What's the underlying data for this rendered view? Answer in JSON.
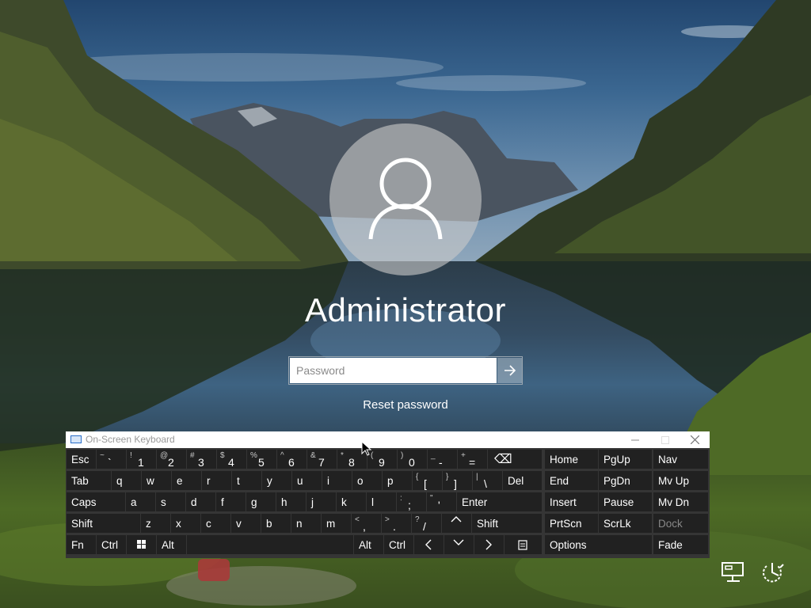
{
  "user": {
    "name": "Administrator"
  },
  "password": {
    "placeholder": "Password"
  },
  "reset_link": "Reset password",
  "osk": {
    "title": "On-Screen Keyboard",
    "keys": {
      "esc": "Esc",
      "tilde_up": "~",
      "tilde_dn": "`",
      "n1_up": "!",
      "n1": "1",
      "n2_up": "@",
      "n2": "2",
      "n3_up": "#",
      "n3": "3",
      "n4_up": "$",
      "n4": "4",
      "n5_up": "%",
      "n5": "5",
      "n6_up": "^",
      "n6": "6",
      "n7_up": "&",
      "n7": "7",
      "n8_up": "*",
      "n8": "8",
      "n9_up": "(",
      "n9": "9",
      "n0_up": ")",
      "n0": "0",
      "minus_up": "_",
      "minus_dn": "-",
      "plus_up": "+",
      "plus_dn": "=",
      "backspace": "⌫",
      "tab": "Tab",
      "q": "q",
      "w": "w",
      "e": "e",
      "r": "r",
      "t": "t",
      "y": "y",
      "u": "u",
      "i": "i",
      "o": "o",
      "p": "p",
      "lbr_up": "{",
      "lbr_dn": "[",
      "rbr_up": "}",
      "rbr_dn": "]",
      "bsl_up": "|",
      "bsl_dn": "\\",
      "del": "Del",
      "caps": "Caps",
      "a": "a",
      "s": "s",
      "d": "d",
      "f": "f",
      "g": "g",
      "h": "h",
      "j": "j",
      "k": "k",
      "l": "l",
      "semi_up": ":",
      "semi_dn": ";",
      "quote_up": "\"",
      "quote_dn": "'",
      "enter": "Enter",
      "shift": "Shift",
      "z": "z",
      "x": "x",
      "c": "c",
      "v": "v",
      "b": "b",
      "n": "n",
      "m": "m",
      "comma_up": "<",
      "comma_dn": ",",
      "period_up": ">",
      "period_dn": ".",
      "slash_up": "?",
      "slash_dn": "/",
      "shift_r": "Shift",
      "fn": "Fn",
      "ctrl": "Ctrl",
      "alt": "Alt",
      "alt_r": "Alt",
      "ctrl_r": "Ctrl",
      "home": "Home",
      "pgup": "PgUp",
      "nav": "Nav",
      "end": "End",
      "pgdn": "PgDn",
      "mvup": "Mv Up",
      "insert": "Insert",
      "pause": "Pause",
      "mvdn": "Mv Dn",
      "prtscn": "PrtScn",
      "scrlk": "ScrLk",
      "dock": "Dock",
      "options": "Options",
      "fade": "Fade"
    }
  },
  "icons": {
    "submit": "arrow-right-icon",
    "network": "network-icon",
    "power": "power-icon",
    "ease_of_access": "ease-of-access-icon",
    "cursor": "mouse-cursor-icon"
  },
  "colors": {
    "key_bg": "#212121",
    "keyboard_bg": "#353535",
    "dim_text": "#888888"
  }
}
